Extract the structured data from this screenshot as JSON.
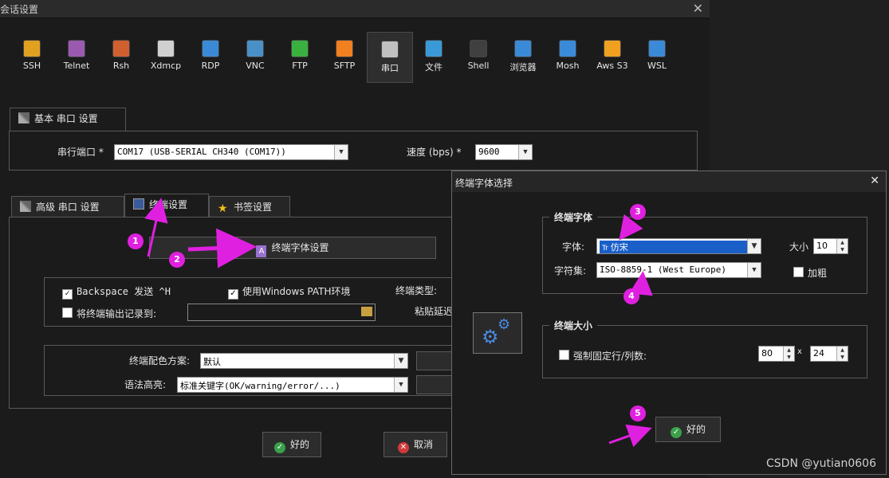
{
  "window": {
    "title": "会话设置",
    "close": "✕"
  },
  "protocols": [
    {
      "label": "SSH",
      "icon": "key-icon",
      "color": "#e0a020"
    },
    {
      "label": "Telnet",
      "icon": "telnet-icon",
      "color": "#9a5ab0"
    },
    {
      "label": "Rsh",
      "icon": "rsh-icon",
      "color": "#d06030"
    },
    {
      "label": "Xdmcp",
      "icon": "xdmcp-icon",
      "color": "#d0d0d0"
    },
    {
      "label": "RDP",
      "icon": "rdp-icon",
      "color": "#3a8ad8"
    },
    {
      "label": "VNC",
      "icon": "vnc-icon",
      "color": "#4a90c8"
    },
    {
      "label": "FTP",
      "icon": "ftp-icon",
      "color": "#3ab040"
    },
    {
      "label": "SFTP",
      "icon": "sftp-icon",
      "color": "#f08020"
    },
    {
      "label": "串口",
      "icon": "serial-icon",
      "color": "#c0c0c0"
    },
    {
      "label": "文件",
      "icon": "file-icon",
      "color": "#3a9ad8"
    },
    {
      "label": "Shell",
      "icon": "shell-icon",
      "color": "#404040"
    },
    {
      "label": "浏览器",
      "icon": "browser-icon",
      "color": "#3a8ad8"
    },
    {
      "label": "Mosh",
      "icon": "mosh-icon",
      "color": "#3a8ad8"
    },
    {
      "label": "Aws S3",
      "icon": "aws-icon",
      "color": "#f0a020"
    },
    {
      "label": "WSL",
      "icon": "wsl-icon",
      "color": "#3a8ad8"
    }
  ],
  "basic": {
    "tab": "基本 串口 设置",
    "port_label": "串行端口 *",
    "port_value": "COM17  (USB-SERIAL CH340 (COM17))",
    "speed_label": "速度 (bps) *",
    "speed_value": "9600"
  },
  "tabs": [
    "高级 串口 设置",
    "终端设置",
    "书签设置"
  ],
  "terminal": {
    "font_button": "终端字体设置",
    "backspace": "Backspace 发送 ^H",
    "win_path": "使用Windows PATH环境",
    "term_type": "终端类型:",
    "log_output": "将终端输出记录到:",
    "paste_delay": "粘贴延迟",
    "color_scheme_label": "终端配色方案:",
    "color_scheme_value": "默认",
    "syntax_label": "语法高亮:",
    "syntax_value": "标准关键字(OK/warning/error/...)"
  },
  "buttons": {
    "ok": "好的",
    "cancel": "取消"
  },
  "font_dialog": {
    "title": "终端字体选择",
    "close": "✕",
    "group_font": "终端字体",
    "font_label": "字体:",
    "font_value": "仿宋",
    "size_label": "大小",
    "size_value": "10",
    "charset_label": "字符集:",
    "charset_value": "ISO-8859-1 (West Europe)",
    "bold_label": "加粗",
    "group_size": "终端大小",
    "fixed_label": "强制固定行/列数:",
    "cols": "80",
    "x": "x",
    "rows": "24",
    "ok": "好的"
  },
  "annotations": [
    "1",
    "2",
    "3",
    "4",
    "5"
  ],
  "watermark": "CSDN @yutian0606"
}
